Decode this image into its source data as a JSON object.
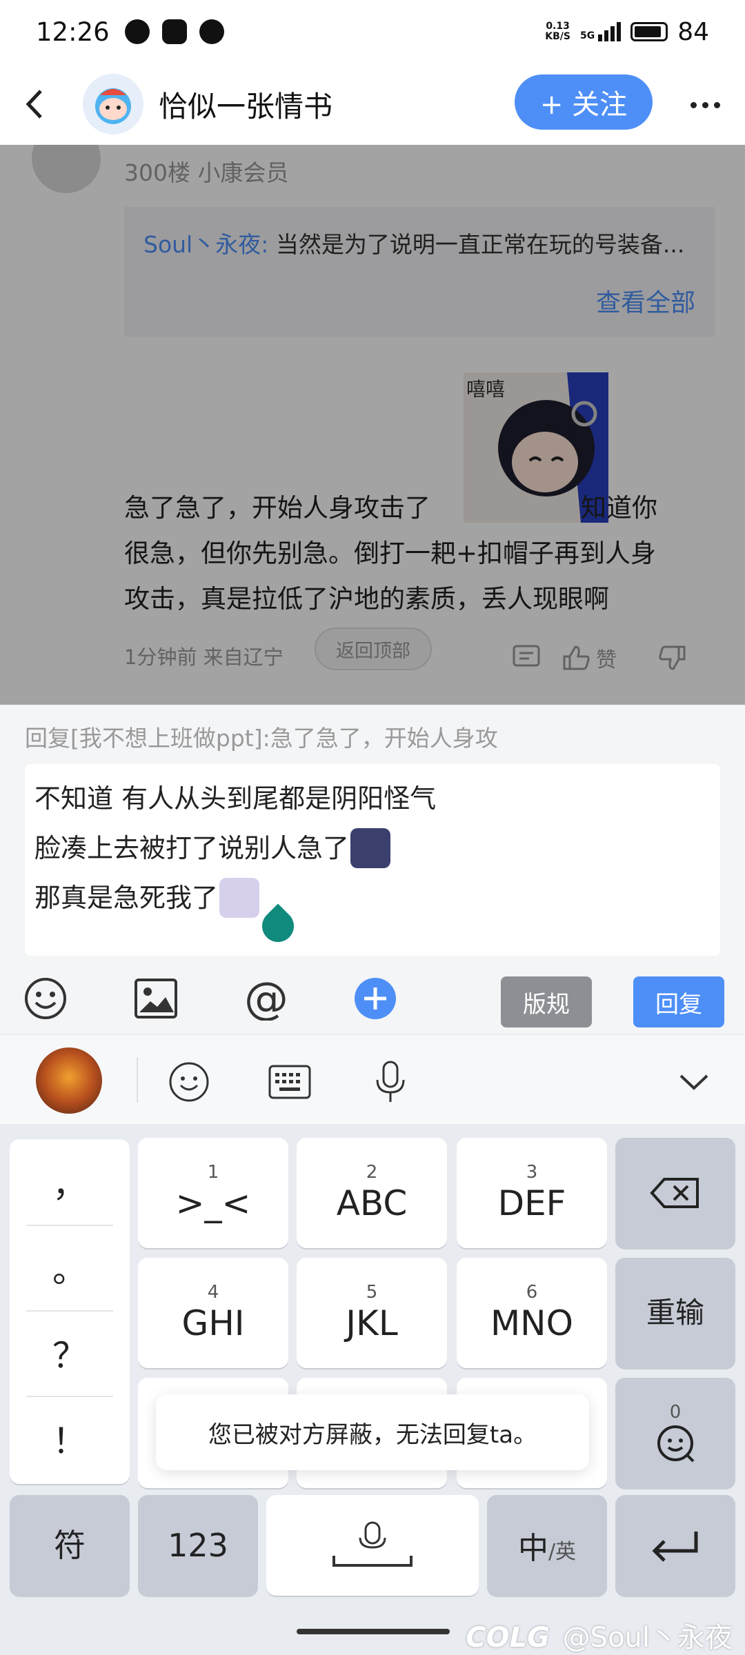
{
  "status_bar": {
    "time": "12:26",
    "net_speed_value": "0.13",
    "net_speed_unit": "KB/S",
    "network_type": "5G",
    "battery": "84"
  },
  "nav": {
    "forum_name": "恰似一张情书",
    "follow_label": "+ 关注"
  },
  "post": {
    "meta": "300楼 小康会员",
    "quote_author": "Soul丶永夜:",
    "quote_text": "当然是为了说明一直正常在玩的号装备...",
    "view_all": "查看全部",
    "sticker_text": "嘻嘻",
    "body_line1_a": "急了急了，开始人身攻击了",
    "body_line1_b": "知道你",
    "body_line2": "很急，但你先别急。倒打一耙+扣帽子再到人身",
    "body_line3": "攻击，真是拉低了沪地的素质，丢人现眼啊",
    "footer_time": "1分钟前 来自辽宁",
    "to_top": "返回顶部",
    "like_label": "赞"
  },
  "reply": {
    "hint": "回复[我不想上班做ppt]:急了急了，开始人身攻",
    "input_lines": [
      "不知道 有人从头到尾都是阴阳怪气",
      "脸凑上去被打了说别人急了",
      "那真是急死我了"
    ],
    "rules_label": "版规",
    "submit_label": "回复"
  },
  "keyboard": {
    "punct_keys": [
      "，",
      "。",
      "？",
      "！"
    ],
    "keys": [
      {
        "num": "1",
        "label": ">_<"
      },
      {
        "num": "2",
        "label": "ABC"
      },
      {
        "num": "3",
        "label": "DEF"
      },
      {
        "num": "4",
        "label": "GHI"
      },
      {
        "num": "5",
        "label": "JKL"
      },
      {
        "num": "6",
        "label": "MNO"
      }
    ],
    "reenter_label": "重输",
    "emoji_key_num": "0",
    "symbol_label": "符",
    "numbers_label": "123",
    "lang_label_main": "中",
    "lang_label_sub": "/英"
  },
  "toast": "您已被对方屏蔽，无法回复ta。",
  "watermark": "@Soul丶永夜",
  "watermark_logo": "COLG",
  "colors": {
    "accent": "#4e8ff7",
    "rules_btn": "#8d8f94",
    "cursor": "#0f8a7d"
  }
}
